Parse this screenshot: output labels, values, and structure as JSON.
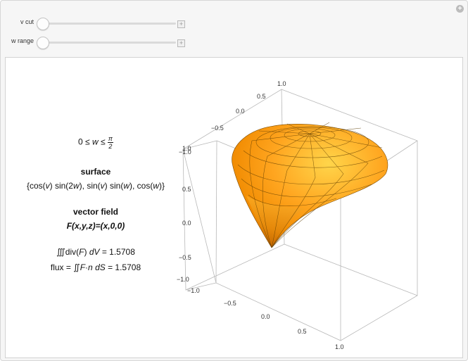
{
  "controls": {
    "v_cut_label": "v cut",
    "w_range_label": "w range",
    "v_cut_value": 0,
    "w_range_value": 0
  },
  "info": {
    "range_left": "0 ≤ ",
    "range_var": "w",
    "range_rel": " ≤ ",
    "range_pi": "π",
    "range_den": "2",
    "surface_title": "surface",
    "surface_formula_a": "{cos(",
    "surface_formula_v1": "v",
    "surface_formula_b": ") sin(2",
    "surface_formula_w1": "w",
    "surface_formula_c": "), sin(",
    "surface_formula_v2": "v",
    "surface_formula_d": ") sin(",
    "surface_formula_w2": "w",
    "surface_formula_e": "), cos(",
    "surface_formula_w3": "w",
    "surface_formula_f": ")}",
    "field_title": "vector field",
    "field_formula": "F(x,y,z)=(x,0,0)",
    "divergence_a": "∭div(",
    "divergence_F": "F",
    "divergence_b": ") ",
    "divergence_dV": "dV",
    "divergence_c": " = 1.5708",
    "flux_a": "flux = ∬",
    "flux_F": "F",
    "flux_dot": "·",
    "flux_n": "n",
    "flux_sp": " ",
    "flux_dS": "dS",
    "flux_b": " = 1.5708"
  },
  "axes": {
    "top_right": {
      "t1": "1.0",
      "t2": "0.5",
      "t3": "0.0",
      "t4": "−0.5",
      "t5": "−1.0"
    },
    "left_vertical": {
      "t1": "1.0",
      "t2": "0.5",
      "t3": "0.0",
      "t4": "−0.5",
      "t5": "−1.0"
    },
    "bottom": {
      "t1": "−1.0",
      "t2": "−0.5",
      "t3": "0.0",
      "t4": "0.5",
      "t5": "1.0"
    }
  },
  "colors": {
    "surface_light": "#ffcc33",
    "surface_mid": "#ff9900",
    "surface_dark": "#b85a00",
    "box": "#b8b8b8"
  }
}
